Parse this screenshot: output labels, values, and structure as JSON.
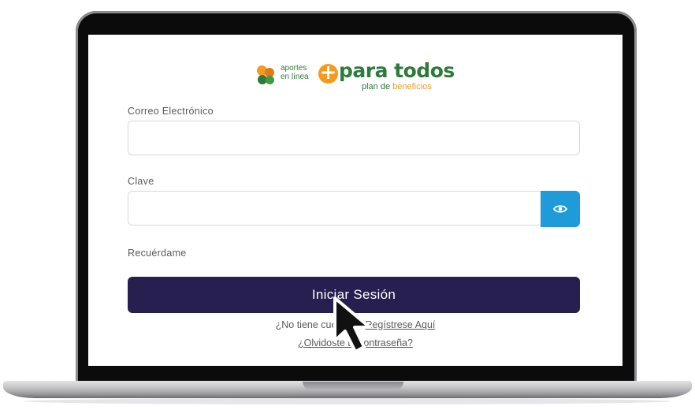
{
  "logo": {
    "line1": "aportes",
    "line2": "en línea",
    "brand": "para todos",
    "sub_prefix": "plan de",
    "sub_highlight": "beneficios"
  },
  "form": {
    "email_label": "Correo Electrónico",
    "email_value": "",
    "password_label": "Clave",
    "password_value": "",
    "remember_label": "Recuérdame",
    "submit_label": "Iniciar Sesión"
  },
  "links": {
    "register_prefix": "¿No tiene cue",
    "register_link": "Regístrese Aquí",
    "forgot_link": "¿Olvidoste tu contraseña?"
  },
  "colors": {
    "brand_green": "#2e7a3c",
    "brand_orange": "#f39a1f",
    "submit_bg": "#261f4f",
    "eye_button_bg": "#1e9bd8"
  },
  "icons": {
    "eye": "eye-icon",
    "cursor": "mouse-pointer-icon"
  }
}
